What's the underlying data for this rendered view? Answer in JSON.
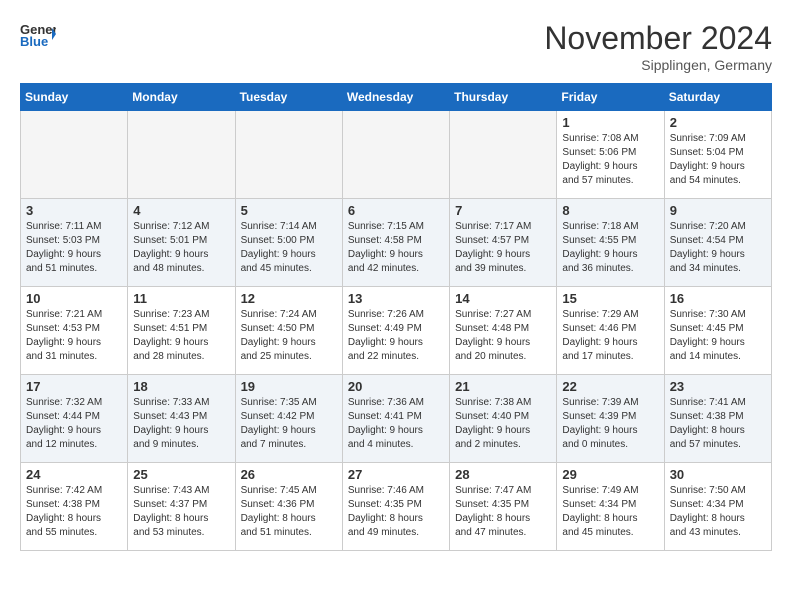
{
  "header": {
    "logo_line1": "General",
    "logo_line2": "Blue",
    "title": "November 2024",
    "location": "Sipplingen, Germany"
  },
  "weekdays": [
    "Sunday",
    "Monday",
    "Tuesday",
    "Wednesday",
    "Thursday",
    "Friday",
    "Saturday"
  ],
  "weeks": [
    [
      {
        "day": "",
        "info": ""
      },
      {
        "day": "",
        "info": ""
      },
      {
        "day": "",
        "info": ""
      },
      {
        "day": "",
        "info": ""
      },
      {
        "day": "",
        "info": ""
      },
      {
        "day": "1",
        "info": "Sunrise: 7:08 AM\nSunset: 5:06 PM\nDaylight: 9 hours\nand 57 minutes."
      },
      {
        "day": "2",
        "info": "Sunrise: 7:09 AM\nSunset: 5:04 PM\nDaylight: 9 hours\nand 54 minutes."
      }
    ],
    [
      {
        "day": "3",
        "info": "Sunrise: 7:11 AM\nSunset: 5:03 PM\nDaylight: 9 hours\nand 51 minutes."
      },
      {
        "day": "4",
        "info": "Sunrise: 7:12 AM\nSunset: 5:01 PM\nDaylight: 9 hours\nand 48 minutes."
      },
      {
        "day": "5",
        "info": "Sunrise: 7:14 AM\nSunset: 5:00 PM\nDaylight: 9 hours\nand 45 minutes."
      },
      {
        "day": "6",
        "info": "Sunrise: 7:15 AM\nSunset: 4:58 PM\nDaylight: 9 hours\nand 42 minutes."
      },
      {
        "day": "7",
        "info": "Sunrise: 7:17 AM\nSunset: 4:57 PM\nDaylight: 9 hours\nand 39 minutes."
      },
      {
        "day": "8",
        "info": "Sunrise: 7:18 AM\nSunset: 4:55 PM\nDaylight: 9 hours\nand 36 minutes."
      },
      {
        "day": "9",
        "info": "Sunrise: 7:20 AM\nSunset: 4:54 PM\nDaylight: 9 hours\nand 34 minutes."
      }
    ],
    [
      {
        "day": "10",
        "info": "Sunrise: 7:21 AM\nSunset: 4:53 PM\nDaylight: 9 hours\nand 31 minutes."
      },
      {
        "day": "11",
        "info": "Sunrise: 7:23 AM\nSunset: 4:51 PM\nDaylight: 9 hours\nand 28 minutes."
      },
      {
        "day": "12",
        "info": "Sunrise: 7:24 AM\nSunset: 4:50 PM\nDaylight: 9 hours\nand 25 minutes."
      },
      {
        "day": "13",
        "info": "Sunrise: 7:26 AM\nSunset: 4:49 PM\nDaylight: 9 hours\nand 22 minutes."
      },
      {
        "day": "14",
        "info": "Sunrise: 7:27 AM\nSunset: 4:48 PM\nDaylight: 9 hours\nand 20 minutes."
      },
      {
        "day": "15",
        "info": "Sunrise: 7:29 AM\nSunset: 4:46 PM\nDaylight: 9 hours\nand 17 minutes."
      },
      {
        "day": "16",
        "info": "Sunrise: 7:30 AM\nSunset: 4:45 PM\nDaylight: 9 hours\nand 14 minutes."
      }
    ],
    [
      {
        "day": "17",
        "info": "Sunrise: 7:32 AM\nSunset: 4:44 PM\nDaylight: 9 hours\nand 12 minutes."
      },
      {
        "day": "18",
        "info": "Sunrise: 7:33 AM\nSunset: 4:43 PM\nDaylight: 9 hours\nand 9 minutes."
      },
      {
        "day": "19",
        "info": "Sunrise: 7:35 AM\nSunset: 4:42 PM\nDaylight: 9 hours\nand 7 minutes."
      },
      {
        "day": "20",
        "info": "Sunrise: 7:36 AM\nSunset: 4:41 PM\nDaylight: 9 hours\nand 4 minutes."
      },
      {
        "day": "21",
        "info": "Sunrise: 7:38 AM\nSunset: 4:40 PM\nDaylight: 9 hours\nand 2 minutes."
      },
      {
        "day": "22",
        "info": "Sunrise: 7:39 AM\nSunset: 4:39 PM\nDaylight: 9 hours\nand 0 minutes."
      },
      {
        "day": "23",
        "info": "Sunrise: 7:41 AM\nSunset: 4:38 PM\nDaylight: 8 hours\nand 57 minutes."
      }
    ],
    [
      {
        "day": "24",
        "info": "Sunrise: 7:42 AM\nSunset: 4:38 PM\nDaylight: 8 hours\nand 55 minutes."
      },
      {
        "day": "25",
        "info": "Sunrise: 7:43 AM\nSunset: 4:37 PM\nDaylight: 8 hours\nand 53 minutes."
      },
      {
        "day": "26",
        "info": "Sunrise: 7:45 AM\nSunset: 4:36 PM\nDaylight: 8 hours\nand 51 minutes."
      },
      {
        "day": "27",
        "info": "Sunrise: 7:46 AM\nSunset: 4:35 PM\nDaylight: 8 hours\nand 49 minutes."
      },
      {
        "day": "28",
        "info": "Sunrise: 7:47 AM\nSunset: 4:35 PM\nDaylight: 8 hours\nand 47 minutes."
      },
      {
        "day": "29",
        "info": "Sunrise: 7:49 AM\nSunset: 4:34 PM\nDaylight: 8 hours\nand 45 minutes."
      },
      {
        "day": "30",
        "info": "Sunrise: 7:50 AM\nSunset: 4:34 PM\nDaylight: 8 hours\nand 43 minutes."
      }
    ]
  ]
}
